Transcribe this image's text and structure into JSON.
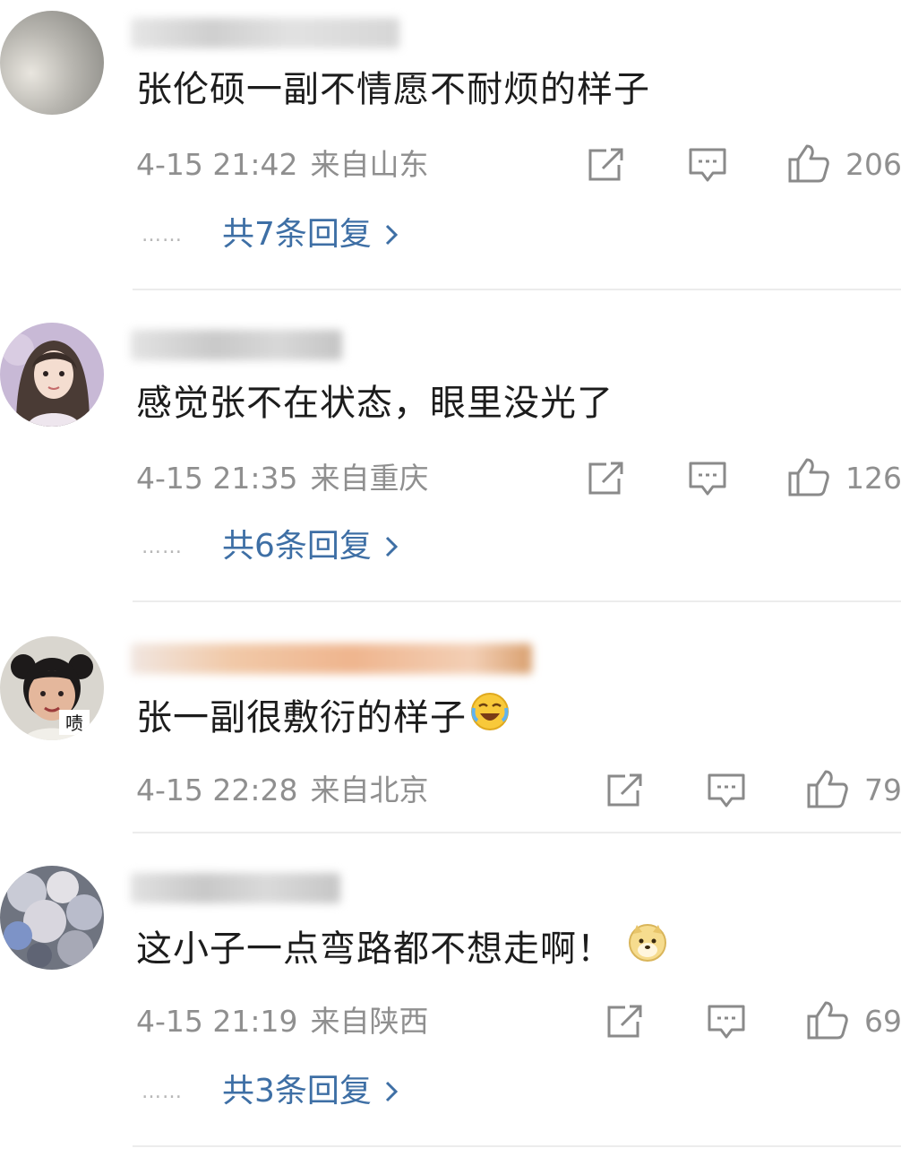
{
  "comments": [
    {
      "text": "张伦硕一副不情愿不耐烦的样子",
      "date": "4-15 21:42",
      "location": "来自山东",
      "likes": "206",
      "replies": "共7条回复",
      "avatar_icon": "sky-avatar",
      "emoji": ""
    },
    {
      "text": "感觉张不在状态，眼里没光了",
      "date": "4-15 21:35",
      "location": "来自重庆",
      "likes": "126",
      "replies": "共6条回复",
      "avatar_icon": "girl-portrait-avatar",
      "emoji": ""
    },
    {
      "text": "张一副很敷衍的样子",
      "date": "4-15 22:28",
      "location": "来自北京",
      "likes": "79",
      "replies": "",
      "avatar_icon": "girl-sticker-avatar",
      "avatar_label": "啧",
      "emoji": "laugh-cry-emoji"
    },
    {
      "text": "这小子一点弯路都不想走啊！",
      "date": "4-15 21:19",
      "location": "来自陕西",
      "likes": "69",
      "replies": "共3条回复",
      "avatar_icon": "blossom-avatar",
      "emoji": "doge-emoji"
    }
  ],
  "reply_dots": "……",
  "colors": {
    "reply_link": "#3e6fa5",
    "meta_text": "#8f8f8f",
    "icon_stroke": "#8a8a8a",
    "divider": "#ececec"
  }
}
